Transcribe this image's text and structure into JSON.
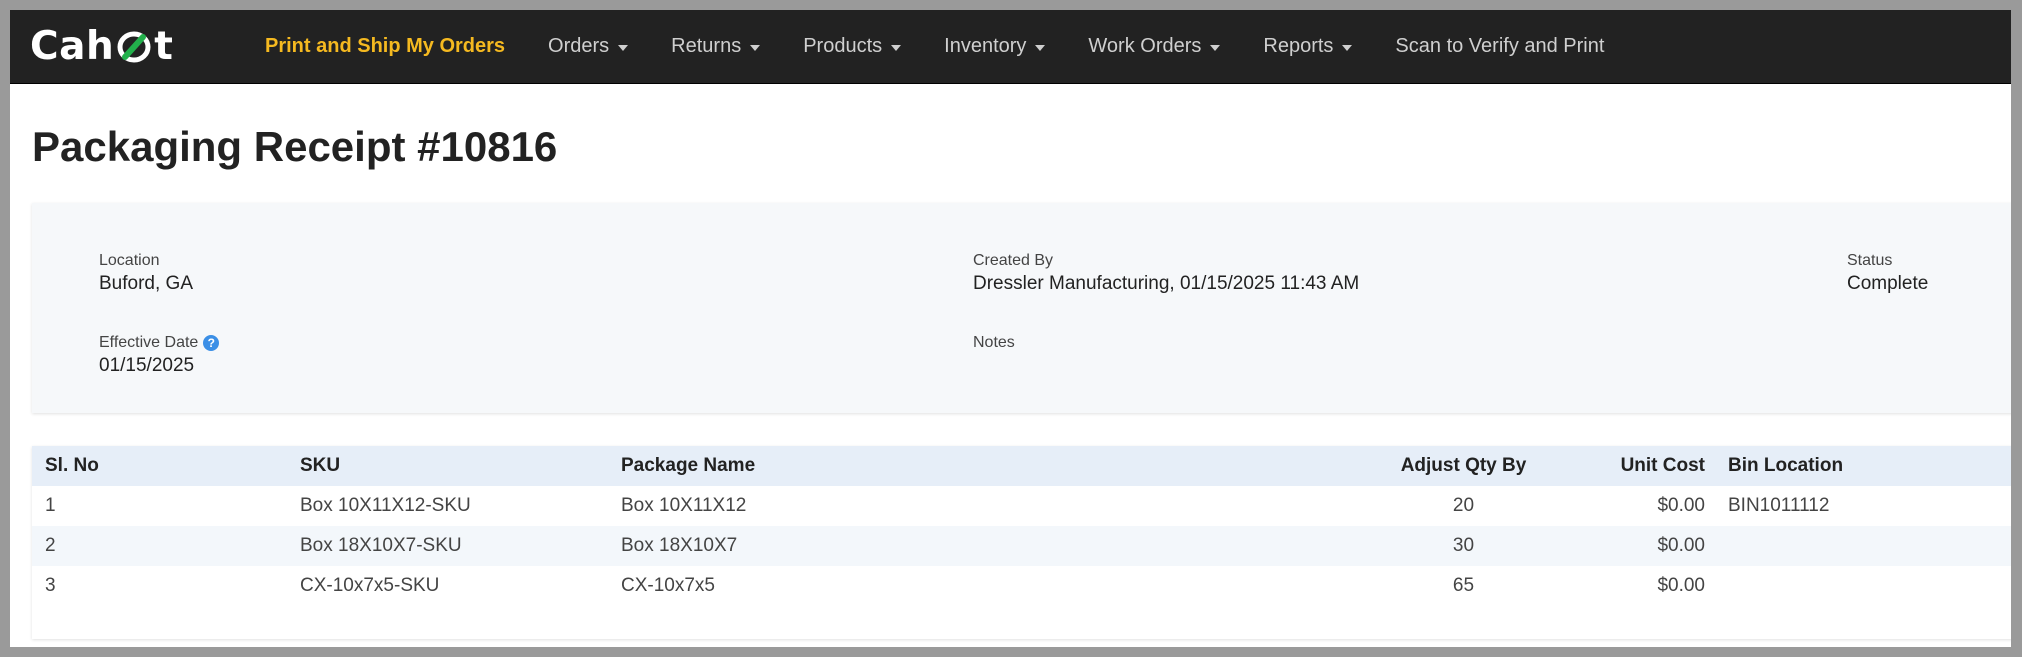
{
  "app": {
    "logo_text_left": "Cah",
    "logo_text_right": "t"
  },
  "nav": {
    "items": [
      {
        "label": "Print and Ship My Orders",
        "active": true,
        "dropdown": false
      },
      {
        "label": "Orders",
        "active": false,
        "dropdown": true
      },
      {
        "label": "Returns",
        "active": false,
        "dropdown": true
      },
      {
        "label": "Products",
        "active": false,
        "dropdown": true
      },
      {
        "label": "Inventory",
        "active": false,
        "dropdown": true
      },
      {
        "label": "Work Orders",
        "active": false,
        "dropdown": true
      },
      {
        "label": "Reports",
        "active": false,
        "dropdown": true
      },
      {
        "label": "Scan to Verify and Print",
        "active": false,
        "dropdown": false
      }
    ]
  },
  "page": {
    "title": "Packaging Receipt #10816"
  },
  "info": {
    "location_label": "Location",
    "location_value": "Buford, GA",
    "created_by_label": "Created By",
    "created_by_value": "Dressler Manufacturing, 01/15/2025 11:43 AM",
    "status_label": "Status",
    "status_value": "Complete",
    "effective_date_label": "Effective Date",
    "effective_date_value": "01/15/2025",
    "notes_label": "Notes",
    "help_icon_glyph": "?"
  },
  "table": {
    "headers": [
      "Sl. No",
      "SKU",
      "Package Name",
      "Adjust Qty By",
      "Unit Cost",
      "Bin Location"
    ],
    "rows": [
      [
        "1",
        "Box 10X11X12-SKU",
        "Box 10X11X12",
        "20",
        "$0.00",
        "BIN1011112"
      ],
      [
        "2",
        "Box 18X10X7-SKU",
        "Box 18X10X7",
        "30",
        "$0.00",
        ""
      ],
      [
        "3",
        "CX-10x7x5-SKU",
        "CX-10x7x5",
        "65",
        "$0.00",
        ""
      ]
    ]
  },
  "colors": {
    "navbar_bg": "#222222",
    "active_nav": "#f5b920",
    "logo_ring_green": "#22b04b",
    "help_blue": "#3b8fe6"
  }
}
